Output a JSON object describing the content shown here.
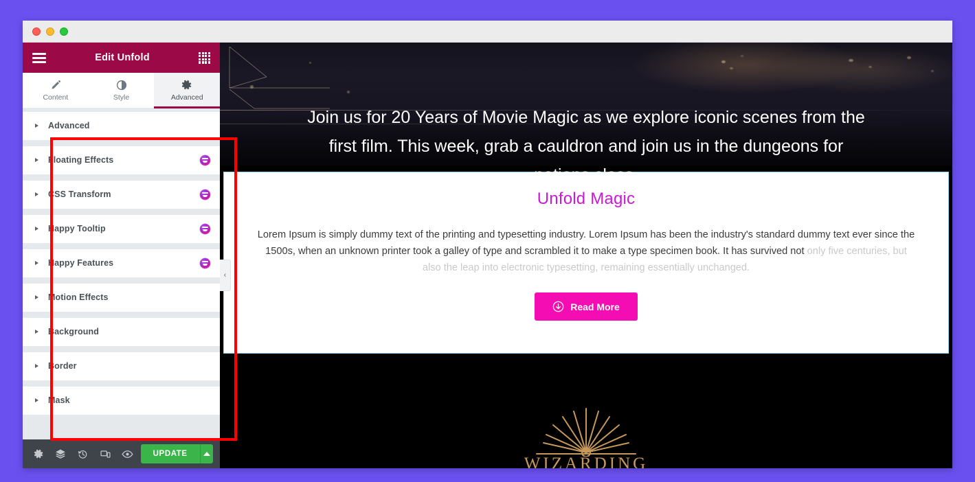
{
  "window": {
    "traffic_lights": [
      "close",
      "minimize",
      "maximize"
    ]
  },
  "panel": {
    "header": {
      "menu_icon": "hamburger-menu-icon",
      "title": "Edit Unfold",
      "widgets_icon": "widgets-grid-icon"
    },
    "tabs": [
      {
        "label": "Content",
        "icon": "pencil-icon",
        "active": false
      },
      {
        "label": "Style",
        "icon": "contrast-icon",
        "active": false
      },
      {
        "label": "Advanced",
        "icon": "gear-icon",
        "active": true
      }
    ],
    "sections": [
      {
        "label": "Advanced",
        "badge": false
      },
      {
        "label": "Floating Effects",
        "badge": true
      },
      {
        "label": "CSS Transform",
        "badge": true
      },
      {
        "label": "Happy Tooltip",
        "badge": true
      },
      {
        "label": "Happy Features",
        "badge": true
      },
      {
        "label": "Motion Effects",
        "badge": false
      },
      {
        "label": "Background",
        "badge": false
      },
      {
        "label": "Border",
        "badge": false
      },
      {
        "label": "Mask",
        "badge": false
      }
    ],
    "footer": {
      "icons": [
        "settings-gear-icon",
        "navigator-layers-icon",
        "history-revisions-icon",
        "responsive-mode-icon",
        "preview-eye-icon"
      ],
      "update_label": "UPDATE",
      "caret_icon": "caret-up-icon"
    },
    "collapse_handle_icon": "chevron-left-icon"
  },
  "preview": {
    "hero_text": "Join us for 20 Years of Movie Magic as we explore iconic scenes from the first film. This week, grab a cauldron and join us in the dungeons for potions class.",
    "card": {
      "title": "Unfold Magic",
      "body_visible": "Lorem Ipsum is simply dummy text of the printing and typesetting industry. Lorem Ipsum has been the industry's standard dummy text ever since the 1500s, when an unknown printer took a galley of type and scrambled it to make a type specimen book. It has survived not ",
      "body_faded": "only five centuries, but also the leap into electronic typesetting, remaining essentially unchanged.",
      "button_label": "Read More",
      "button_icon": "circle-arrow-down-icon"
    },
    "footer": {
      "logo_icon": "wand-fan-logo",
      "brand_word": "WIZARDING"
    }
  },
  "annotation": {
    "type": "red-highlight-rectangle",
    "color": "#ff0000"
  },
  "colors": {
    "desktop_purple": "#6B50F0",
    "panel_header_maroon": "#9B0A46",
    "update_green": "#39b54a",
    "card_title_magenta": "#cc19d6",
    "button_pink": "#F50DB4",
    "selection_blue": "#8ed3f0",
    "annotation_red": "#ff0000"
  }
}
